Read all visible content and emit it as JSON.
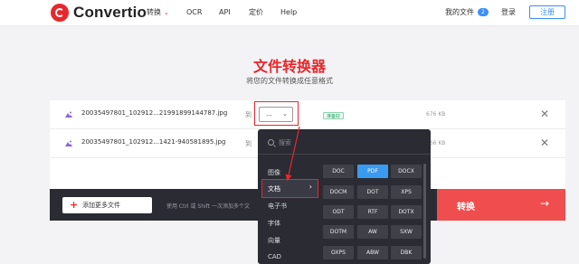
{
  "header": {
    "logo_text": "Convertio",
    "nav": {
      "convert": "转换",
      "ocr": "OCR",
      "api": "API",
      "pricing": "定价",
      "help": "Help"
    },
    "my_files": "我的文件",
    "my_files_count": "2",
    "login": "登录",
    "signup": "注册"
  },
  "main": {
    "title": "文件转换器",
    "subtitle": "将您的文件转换成任意格式"
  },
  "files": [
    {
      "name": "20035497801_102912...21991899144787.jpg",
      "to": "到",
      "select_value": "...",
      "status": "准备好",
      "size": "676 KB"
    },
    {
      "name": "20035497801_102912...1421-940581895.jpg",
      "to": "到",
      "size": "666 KB"
    }
  ],
  "actions": {
    "add_more": "添加更多文件",
    "hint": "使用 Ctrl 或 Shift 一次添加多个文",
    "convert": "转换"
  },
  "dropdown": {
    "search_placeholder": "搜索",
    "categories": [
      "图像",
      "文档",
      "电子书",
      "字体",
      "向量",
      "CAD"
    ],
    "active_category": "文档",
    "formats": [
      "DOC",
      "PDF",
      "DOCX",
      "DOCM",
      "DOT",
      "XPS",
      "ODT",
      "RTF",
      "DOTX",
      "DOTM",
      "AW",
      "SXW",
      "OXPS",
      "ABW",
      "DBK"
    ],
    "selected_format": "PDF"
  },
  "colors": {
    "brand_red": "#e8272c",
    "accent_blue": "#3a8ff7",
    "dark_panel": "#2b2b33"
  }
}
